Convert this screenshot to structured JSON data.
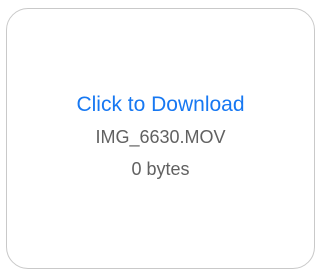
{
  "attachment": {
    "download_label": "Click to Download",
    "file_name": "IMG_6630.MOV",
    "file_size": "0 bytes"
  },
  "colors": {
    "link": "#1778f2",
    "meta_text": "#616161",
    "border": "#c9c9c9"
  }
}
